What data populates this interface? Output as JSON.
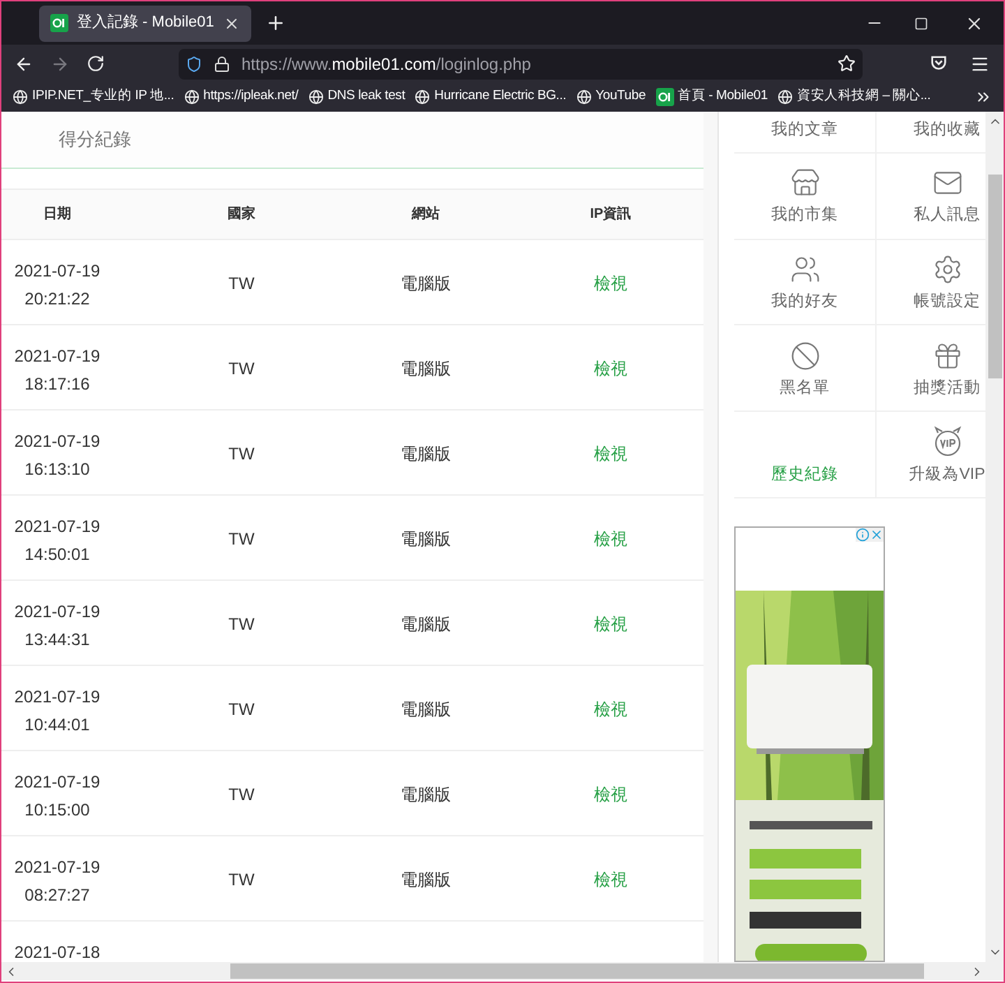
{
  "browser": {
    "tab": {
      "title": "登入記錄 - Mobile01",
      "selected": true
    },
    "url": {
      "prefix": "https://www.",
      "domain": "mobile01.com",
      "path": "/loginlog.php"
    },
    "forward_disabled": true,
    "bookmarks": [
      {
        "label": "IPIP.NET_专业的 IP 地...",
        "kind": "globe"
      },
      {
        "label": "https://ipleak.net/",
        "kind": "globe"
      },
      {
        "label": "DNS leak test",
        "kind": "globe"
      },
      {
        "label": "Hurricane Electric BG...",
        "kind": "globe"
      },
      {
        "label": "YouTube",
        "kind": "globe"
      },
      {
        "label": "首頁 - Mobile01",
        "kind": "site"
      },
      {
        "label": "資安人科技網 – 關心...",
        "kind": "globe"
      }
    ]
  },
  "card": {
    "title": "得分紀錄"
  },
  "table": {
    "columns": [
      "日期",
      "國家",
      "網站",
      "IP資訊"
    ],
    "rows": [
      {
        "date": "2021-07-19",
        "time": "20:21:22",
        "country": "TW",
        "site": "電腦版",
        "ip": "檢視"
      },
      {
        "date": "2021-07-19",
        "time": "18:17:16",
        "country": "TW",
        "site": "電腦版",
        "ip": "檢視"
      },
      {
        "date": "2021-07-19",
        "time": "16:13:10",
        "country": "TW",
        "site": "電腦版",
        "ip": "檢視"
      },
      {
        "date": "2021-07-19",
        "time": "14:50:01",
        "country": "TW",
        "site": "電腦版",
        "ip": "檢視"
      },
      {
        "date": "2021-07-19",
        "time": "13:44:31",
        "country": "TW",
        "site": "電腦版",
        "ip": "檢視"
      },
      {
        "date": "2021-07-19",
        "time": "10:44:01",
        "country": "TW",
        "site": "電腦版",
        "ip": "檢視"
      },
      {
        "date": "2021-07-19",
        "time": "10:15:00",
        "country": "TW",
        "site": "電腦版",
        "ip": "檢視"
      },
      {
        "date": "2021-07-19",
        "time": "08:27:27",
        "country": "TW",
        "site": "電腦版",
        "ip": "檢視"
      },
      {
        "date": "2021-07-18"
      }
    ]
  },
  "sidebar": {
    "items": [
      {
        "label": "我的文章",
        "kind": "plain",
        "selected": false
      },
      {
        "label": "我的收藏",
        "kind": "plain",
        "selected": false
      },
      {
        "label": "我的市集",
        "kind": "store",
        "selected": false
      },
      {
        "label": "私人訊息",
        "kind": "mail",
        "selected": false
      },
      {
        "label": "我的好友",
        "kind": "users",
        "selected": false
      },
      {
        "label": "帳號設定",
        "kind": "gear",
        "selected": false
      },
      {
        "label": "黑名單",
        "kind": "ban",
        "selected": false
      },
      {
        "label": "抽獎活動",
        "kind": "gift",
        "selected": false
      },
      {
        "label": "歷史紀錄",
        "kind": "plain",
        "selected": true
      },
      {
        "label": "升級為VIP",
        "kind": "vip",
        "selected": false
      }
    ]
  }
}
